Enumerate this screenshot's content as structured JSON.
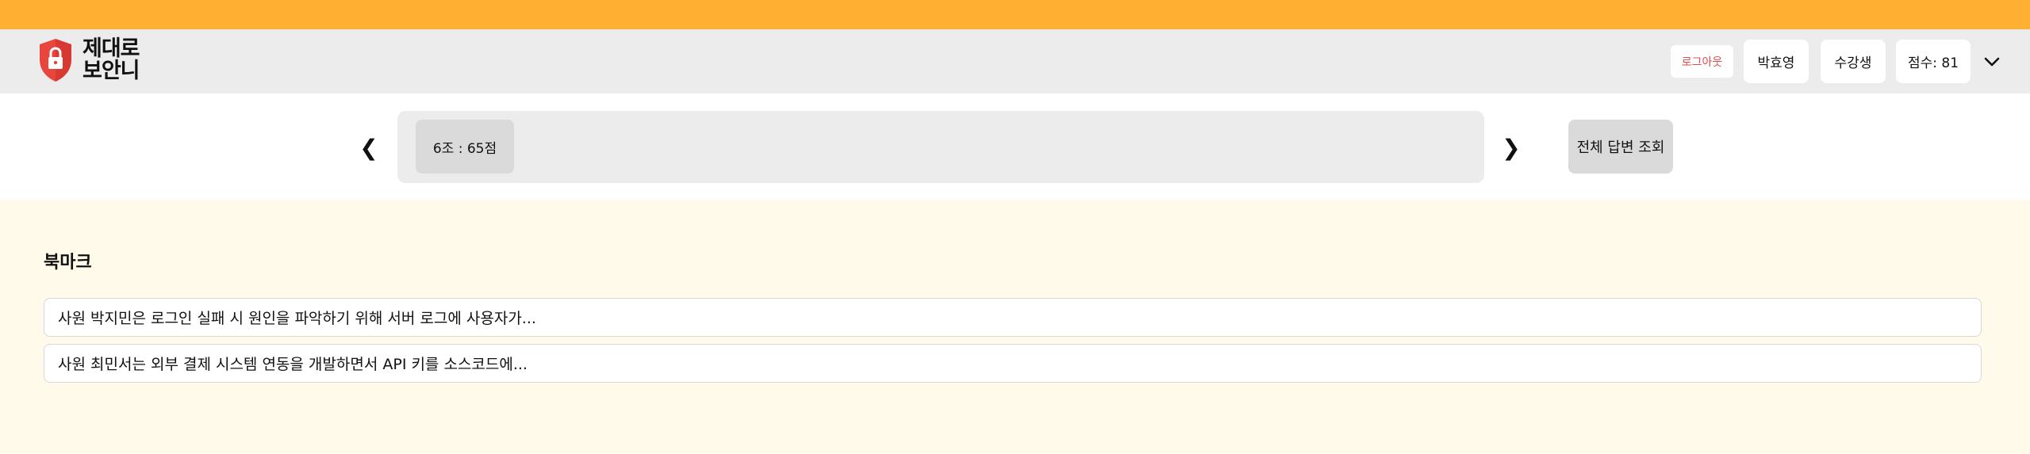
{
  "colors": {
    "accent": "#ffb031",
    "logout": "#e5484d",
    "logo_shield": "#e8453c"
  },
  "logo": {
    "line1": "제대로",
    "line2": "보안니",
    "icon": "shield-lock-icon"
  },
  "header": {
    "logout_label": "로그아웃",
    "user_name": "박효영",
    "role": "수강생",
    "score": "점수: 81",
    "menu_icon": "chevron-down-icon"
  },
  "score_bar": {
    "prev_label": "❮",
    "next_label": "❯",
    "team_score": "6조 : 65점",
    "all_answers_label": "전체 답변 조회"
  },
  "bookmarks": {
    "title": "북마크",
    "items": [
      {
        "text": "사원 박지민은 로그인 실패 시 원인을 파악하기 위해 서버 로그에 사용자가..."
      },
      {
        "text": "사원 최민서는 외부 결제 시스템 연동을 개발하면서 API 키를 소스코드에..."
      }
    ]
  }
}
